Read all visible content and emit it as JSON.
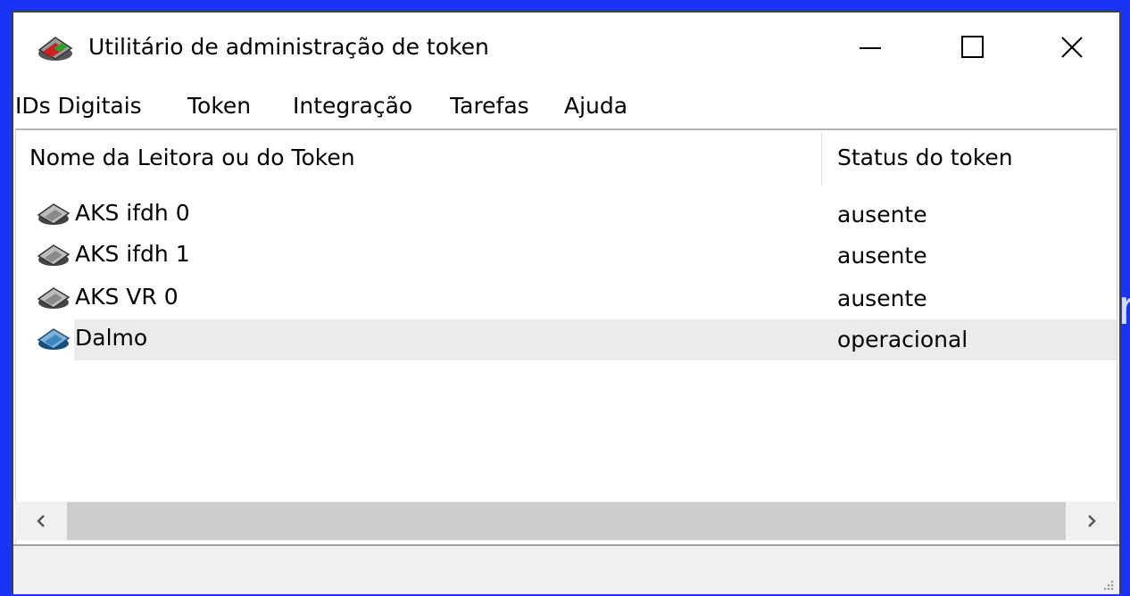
{
  "window": {
    "title": "Utilitário de administração de token",
    "controls": {
      "minimize": "minimize",
      "maximize": "maximize",
      "close": "close"
    }
  },
  "menu": [
    "IDs Digitais",
    "Token",
    "Integração",
    "Tarefas",
    "Ajuda"
  ],
  "list": {
    "columns": [
      "Nome da Leitora ou do Token",
      "Status do token"
    ],
    "rows": [
      {
        "name": "AKS ifdh 0",
        "status": "ausente",
        "icon": "reader-gray-icon"
      },
      {
        "name": "AKS ifdh 1",
        "status": "ausente",
        "icon": "reader-gray-icon"
      },
      {
        "name": "AKS VR 0",
        "status": "ausente",
        "icon": "reader-gray-icon"
      },
      {
        "name": "Dalmo",
        "status": "operacional",
        "icon": "reader-blue-icon",
        "selected": true
      }
    ]
  },
  "colors": {
    "desktop": "#1a33f5",
    "selection": "#ebebeb",
    "scroll_thumb": "#cdcdcd"
  }
}
